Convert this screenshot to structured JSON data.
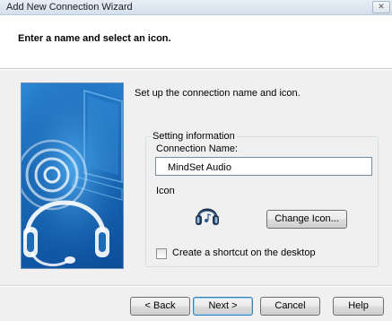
{
  "window": {
    "title": "Add New Connection Wizard",
    "close_glyph": "✕"
  },
  "header": {
    "title": "Enter a name and select an icon."
  },
  "main": {
    "intro": "Set up the connection name and icon.",
    "group_label": "Setting information",
    "connection_name_label": "Connection Name:",
    "connection_name_value": "MindSet Audio",
    "icon_label": "Icon",
    "icon_name": "headset-icon",
    "change_icon_label": "Change Icon...",
    "shortcut_label": "Create a shortcut on the desktop",
    "shortcut_checked": false
  },
  "footer": {
    "back_label": "< Back",
    "next_label": "Next >",
    "cancel_label": "Cancel",
    "help_label": "Help"
  },
  "colors": {
    "art_blue": "#1b6cb9",
    "default_button_border": "#3c7fb1"
  }
}
